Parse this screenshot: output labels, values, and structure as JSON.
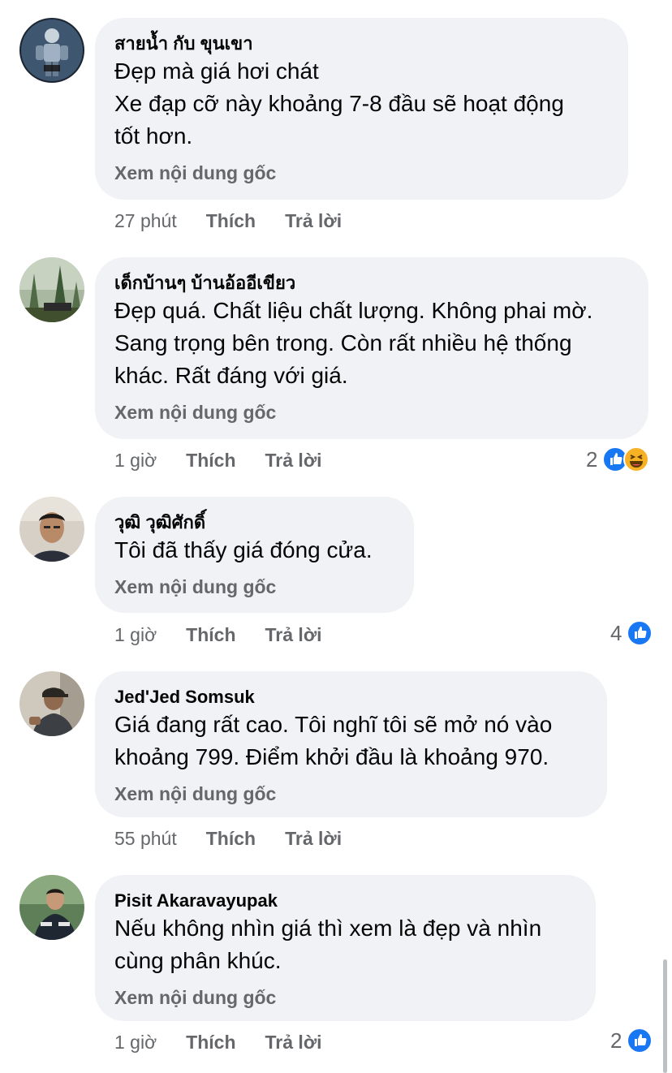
{
  "comments": [
    {
      "author": "สายน้ำ กับ ขุนเขา",
      "lines": [
        "Đẹp mà giá hơi chát",
        "Xe đạp cỡ này khoảng 7-8 đầu sẽ hoạt động",
        "tốt hơn."
      ],
      "see_original": "Xem nội dung gốc",
      "time": "27 phút",
      "like_label": "Thích",
      "reply_label": "Trả lời",
      "reaction_count": "",
      "avatar_icon": "robot-figure-avatar"
    },
    {
      "author": "เด็กบ้านๆ บ้านอ้ออีเขียว",
      "lines": [
        "Đẹp quá. Chất liệu chất lượng. Không phai mờ.",
        "Sang trọng bên trong. Còn rất nhiều hệ thống",
        "khác. Rất đáng với giá."
      ],
      "see_original": "Xem nội dung gốc",
      "time": "1 giờ",
      "like_label": "Thích",
      "reply_label": "Trả lời",
      "reaction_count": "2",
      "reactions": [
        "like-icon",
        "haha-icon"
      ],
      "avatar_icon": "trees-avatar"
    },
    {
      "author": "วุฒิ วุฒิศักดิ์",
      "lines": [
        "Tôi đã thấy giá đóng cửa."
      ],
      "see_original": "Xem nội dung gốc",
      "time": "1 giờ",
      "like_label": "Thích",
      "reply_label": "Trả lời",
      "reaction_count": "4",
      "reactions": [
        "like-icon"
      ],
      "avatar_icon": "man-portrait-avatar"
    },
    {
      "author": "Jed'Jed Somsuk",
      "lines": [
        "Giá đang rất cao. Tôi nghĩ tôi sẽ mở nó vào",
        "khoảng 799. Điểm khởi đầu là khoảng 970."
      ],
      "see_original": "Xem nội dung gốc",
      "time": "55 phút",
      "like_label": "Thích",
      "reply_label": "Trả lời",
      "reaction_count": "",
      "avatar_icon": "man-cap-avatar"
    },
    {
      "author": "Pisit Akaravayupak",
      "lines": [
        "Nếu không nhìn giá thì xem là đẹp và nhìn",
        "cùng phân khúc."
      ],
      "see_original": "Xem nội dung gốc",
      "time": "1 giờ",
      "like_label": "Thích",
      "reply_label": "Trả lời",
      "reaction_count": "2",
      "reactions": [
        "like-icon"
      ],
      "avatar_icon": "man-jacket-avatar"
    }
  ],
  "colors": {
    "bubble": "#f0f2f5",
    "meta_text": "#65676b",
    "like_blue": "#1877f2",
    "haha_yellow": "#f7b125"
  }
}
